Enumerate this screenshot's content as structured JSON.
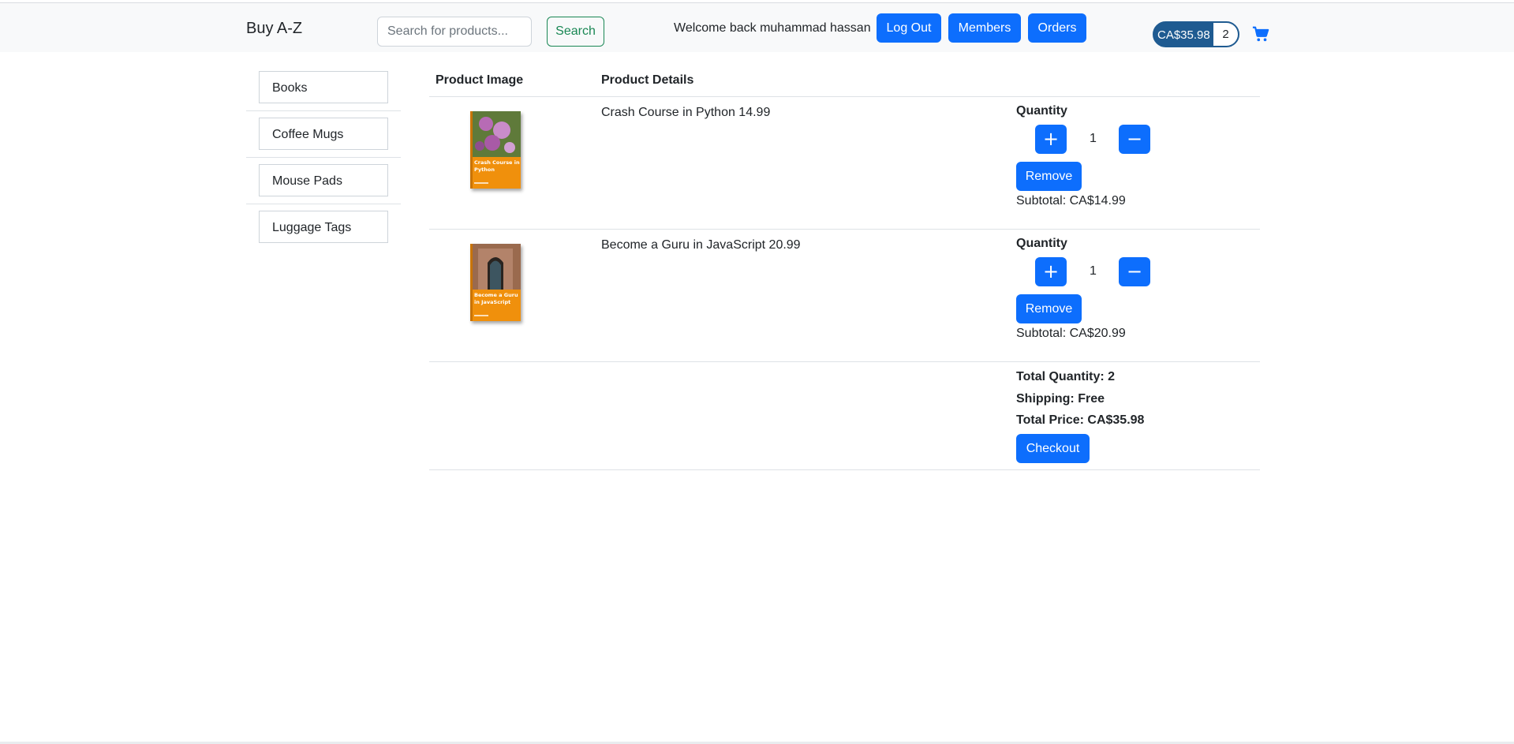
{
  "header": {
    "brand": "Buy A-Z",
    "search_placeholder": "Search for products...",
    "search_button": "Search",
    "welcome": "Welcome back muhammad hassan",
    "logout": "Log Out",
    "members": "Members",
    "orders": "Orders",
    "cart_total": "CA$35.98",
    "cart_count": "2",
    "cart_icon": "cart-icon"
  },
  "sidebar": {
    "items": [
      {
        "label": "Books"
      },
      {
        "label": "Coffee Mugs"
      },
      {
        "label": "Mouse Pads"
      },
      {
        "label": "Luggage Tags"
      }
    ]
  },
  "table": {
    "headers": {
      "image": "Product Image",
      "details": "Product Details"
    },
    "rows": [
      {
        "name": "Crash Course in Python 14.99",
        "cover_title": "Crash Course in Python",
        "quantity_label": "Quantity",
        "quantity": "1",
        "plus": "+",
        "minus": "−",
        "remove": "Remove",
        "subtotal": "Subtotal: CA$14.99"
      },
      {
        "name": "Become a Guru in JavaScript 20.99",
        "cover_title": "Become a Guru in JavaScript",
        "quantity_label": "Quantity",
        "quantity": "1",
        "plus": "+",
        "minus": "−",
        "remove": "Remove",
        "subtotal": "Subtotal: CA$20.99"
      }
    ]
  },
  "summary": {
    "total_quantity": "Total Quantity: 2",
    "shipping": "Shipping: Free",
    "total_price": "Total Price: CA$35.98",
    "checkout": "Checkout"
  },
  "colors": {
    "primary": "#0d6efd",
    "success": "#198754",
    "cart_pill": "#1f5b91",
    "book_cover": "#f0900c"
  }
}
